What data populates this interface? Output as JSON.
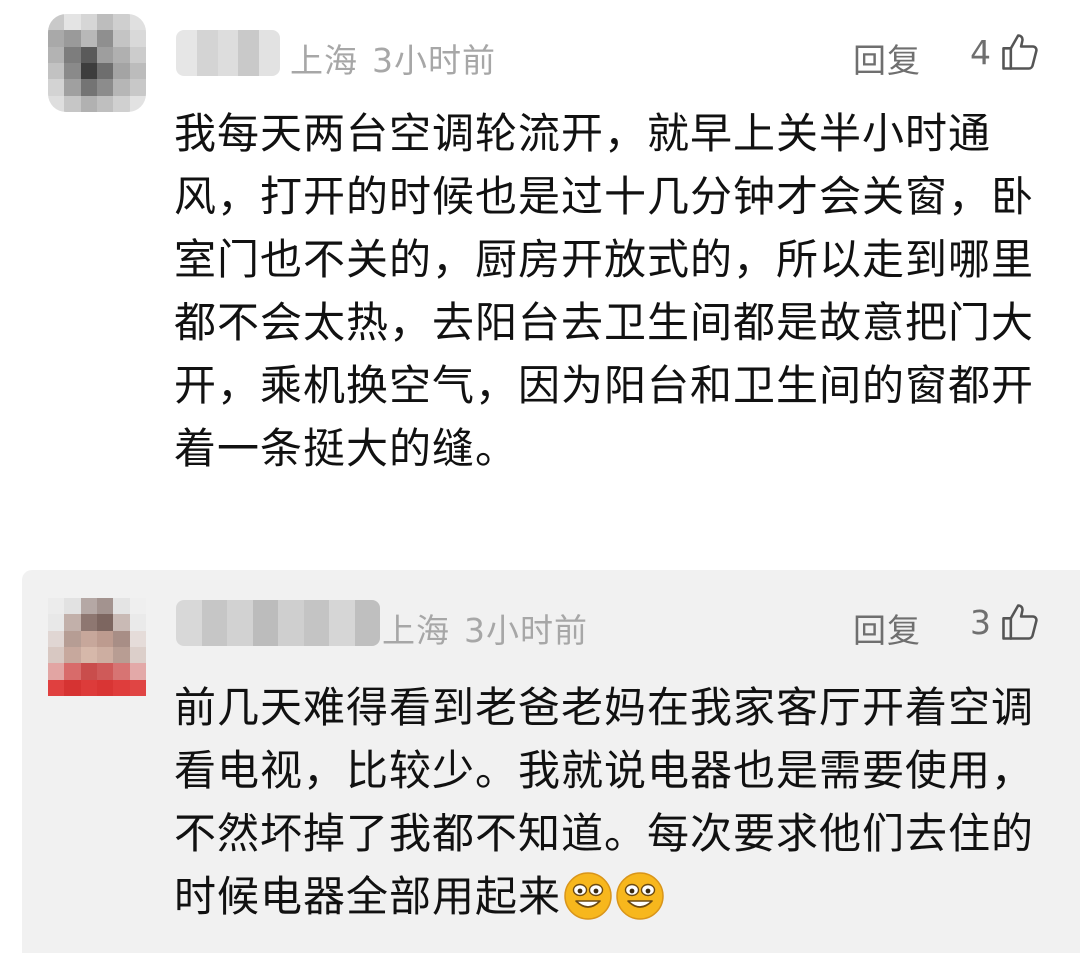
{
  "comments": [
    {
      "location": "上海",
      "time": "3小时前",
      "reply_label": "回复",
      "likes": "4",
      "text": "我每天两台空调轮流开，就早上关半小时通风，打开的时候也是过十几分钟才会关窗，卧室门也不关的，厨房开放式的，所以走到哪里都不会太热，去阳台去卫生间都是故意把门大开，乘机换空气，因为阳台和卫生间的窗都开着一条挺大的缝。"
    },
    {
      "location": "上海",
      "time": "3小时前",
      "reply_label": "回复",
      "likes": "3",
      "text": "前几天难得看到老爸老妈在我家客厅开着空调看电视，比较少。我就说电器也是需要使用，不然坏掉了我都不知道。每次要求他们去住的时候电器全部用起来",
      "emojis": [
        "grinning-face-emoji",
        "grinning-face-emoji"
      ]
    }
  ],
  "icons": {
    "like": "thumbs-up-outline-icon"
  },
  "colors": {
    "meta_text": "#a7a7a7",
    "action_text": "#6f6f6f",
    "body_text": "#111111",
    "reply_background": "#f1f1f1",
    "emoji_yellow": "#f7b71d"
  }
}
